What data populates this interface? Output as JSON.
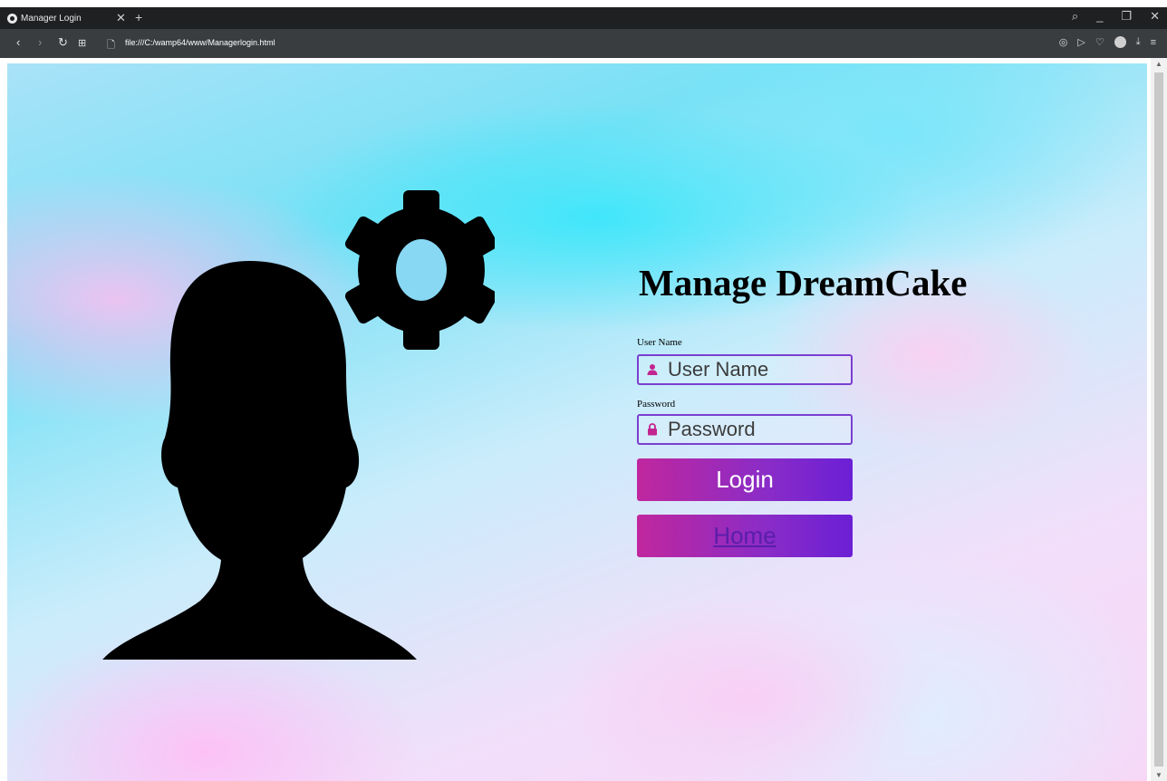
{
  "browser": {
    "tab_title": "Manager Login",
    "url": "file:///C:/wamp64/www/Managerlogin.html"
  },
  "page": {
    "title": "Manage DreamCake",
    "username": {
      "label": "User Name",
      "placeholder": "User Name",
      "value": ""
    },
    "password": {
      "label": "Password",
      "placeholder": "Password",
      "value": ""
    },
    "login_button": "Login",
    "home_link": "Home"
  },
  "icons": {
    "username": "user-icon",
    "password": "lock-icon",
    "illustration": "person-with-gear"
  },
  "colors": {
    "button_gradient_start": "#c0279e",
    "button_gradient_end": "#6b1fd5",
    "input_border": "#7a3fd0",
    "icon_accent": "#c2258f"
  }
}
